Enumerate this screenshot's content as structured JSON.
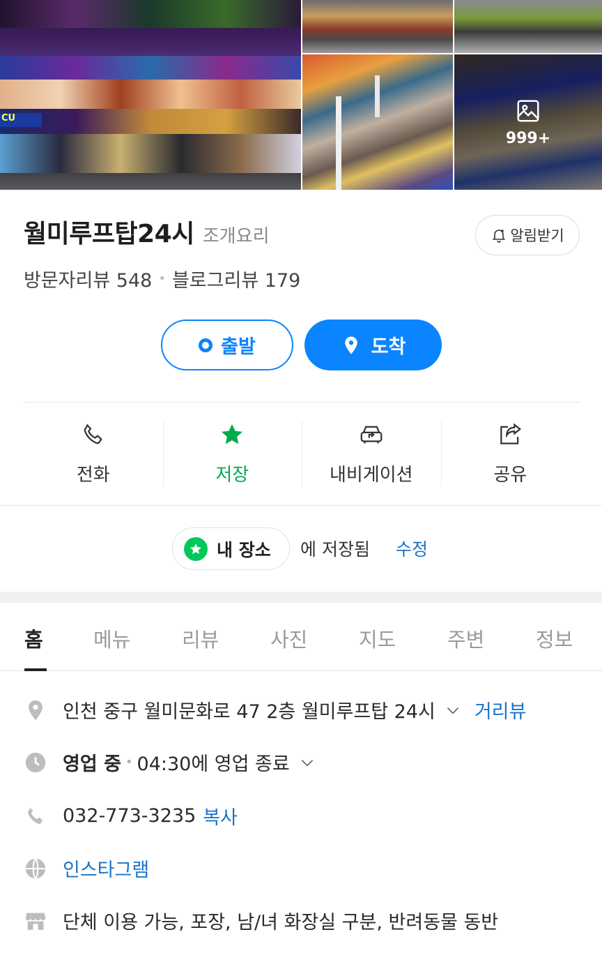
{
  "gallery": {
    "main_sign_text": "CU",
    "more_count": "999+"
  },
  "place": {
    "name": "월미루프탑24시",
    "category": "조개요리",
    "alarm_label": "알림받기"
  },
  "reviews": {
    "visitor_label": "방문자리뷰",
    "visitor_count": "548",
    "blog_label": "블로그리뷰",
    "blog_count": "179"
  },
  "route": {
    "start_label": "출발",
    "end_label": "도착"
  },
  "actions": {
    "call": "전화",
    "save": "저장",
    "navigation": "내비게이션",
    "share": "공유"
  },
  "saved": {
    "list_name": "내 장소",
    "status_text": "에 저장됨",
    "edit_label": "수정"
  },
  "tabs": [
    "홈",
    "메뉴",
    "리뷰",
    "사진",
    "지도",
    "주변",
    "정보"
  ],
  "info": {
    "address": "인천 중구 월미문화로 47 2층 월미루프탑 24시",
    "street_view": "거리뷰",
    "hours_status": "영업 중",
    "hours_detail": "04:30에 영업 종료",
    "phone": "032-773-3235",
    "copy_label": "복사",
    "instagram": "인스타그램",
    "amenities": "단체 이용 가능, 포장, 남/녀 화장실 구분, 반려동물 동반"
  },
  "colors": {
    "primary_blue": "#0a84ff",
    "link_blue": "#1a73c8",
    "save_green": "#03a94d"
  }
}
